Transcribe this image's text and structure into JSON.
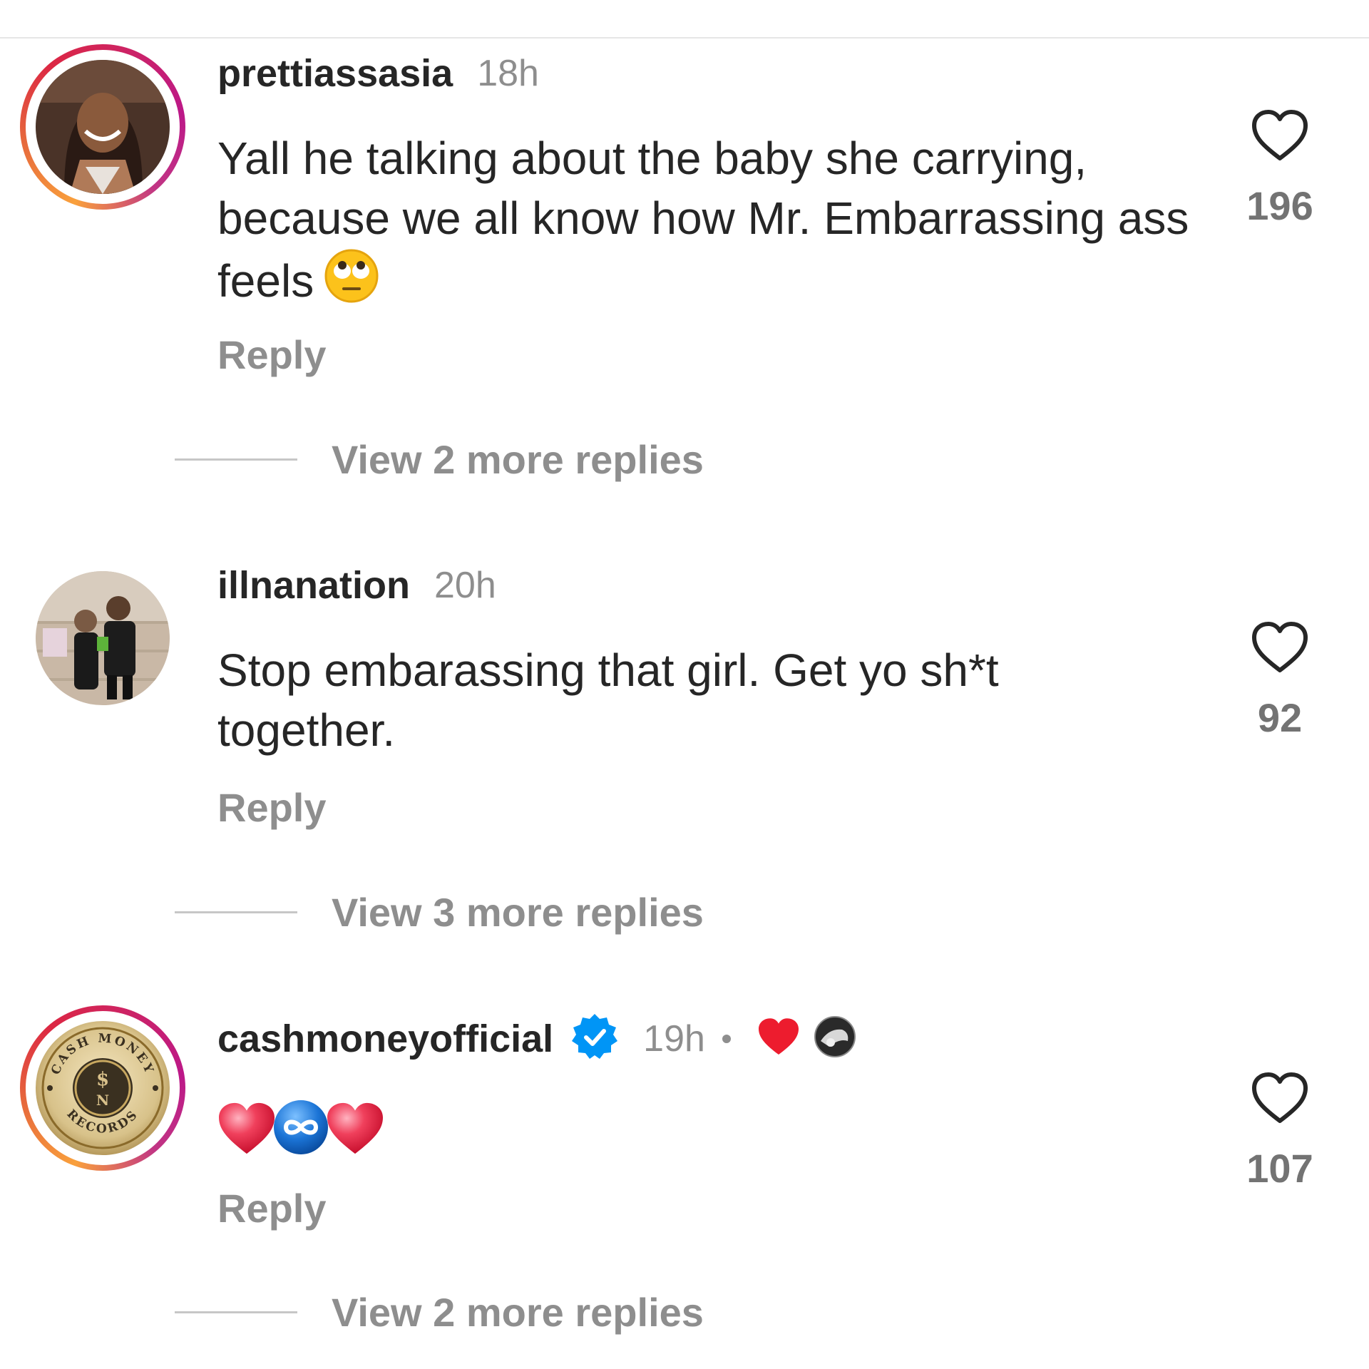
{
  "comments": [
    {
      "username": "prettiassasia",
      "time": "18h",
      "text": "Yall he talking about the baby she carrying, because we all know how Mr. Embarrassing ass feels",
      "emoji_icon": "face-with-rolling-eyes-icon",
      "reply_label": "Reply",
      "likes": "196",
      "view_more": "View 2 more replies",
      "story_ring": true
    },
    {
      "username": "illnanation",
      "time": "20h",
      "text": "Stop embarassing that girl. Get yo sh*t together.",
      "reply_label": "Reply",
      "likes": "92",
      "view_more": "View 3 more replies",
      "story_ring": false
    },
    {
      "username": "cashmoneyofficial",
      "verified": true,
      "time": "19h",
      "reaction_icons": [
        "red-heart-icon",
        "author-avatar-icon"
      ],
      "text_emojis": [
        "red-heart-icon",
        "infinity-icon",
        "red-heart-icon"
      ],
      "reply_label": "Reply",
      "likes": "107",
      "view_more": "View 2 more replies",
      "story_ring": true,
      "avatar_text": {
        "top": "CASH MONEY",
        "bottom": "RECORDS"
      }
    }
  ],
  "colors": {
    "text": "#262626",
    "muted": "#8e8e8e",
    "verified": "#0095f6",
    "heart": "#ed4956",
    "ring_start": "#f9a03c",
    "ring_end": "#bc1888"
  }
}
